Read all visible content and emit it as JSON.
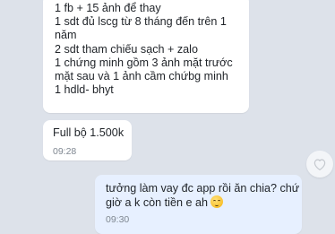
{
  "messages": [
    {
      "direction": "incoming",
      "lines": [
        "1 fb + 15 ảnh để thay",
        "1  sdt  đủ lscg  từ 8 tháng đến trên 1",
        "năm",
        "2 sdt tham chiếu sạch + zalo",
        "1 chứng minh gồm 3 ảnh  mặt trước",
        "mặt sau và 1 ảnh cầm chứbg minh",
        "1 hdld- bhyt"
      ]
    },
    {
      "direction": "incoming",
      "lines": [
        "Full bộ 1.500k"
      ],
      "time": "09:28"
    },
    {
      "direction": "outgoing",
      "lines": [
        "tưởng làm vay đc app rồi ăn chia? chứ",
        "giờ a k còn tiền e ah"
      ],
      "emoji": "slightly-frowning-face-emoji",
      "time": "09:30"
    }
  ],
  "reaction_icon": "heart-outline-icon",
  "colors": {
    "background": "#dde2ea",
    "incoming_bubble": "#ffffff",
    "outgoing_bubble": "#e7f0ff",
    "time_text": "#7f8791"
  }
}
